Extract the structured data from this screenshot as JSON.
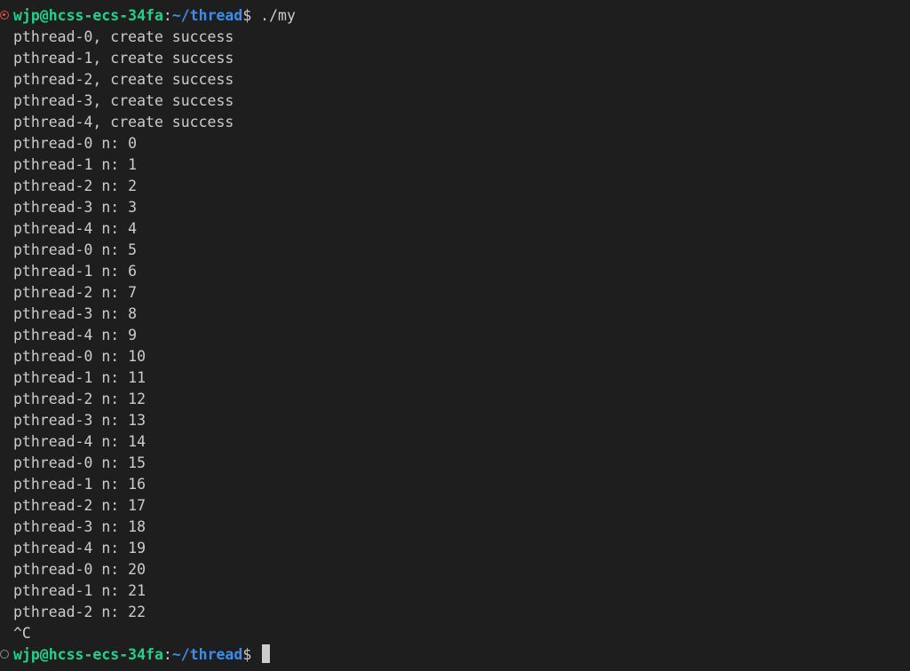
{
  "terminal": {
    "prompt": {
      "user_host": "wjp@hcss-ecs-34fa",
      "colon": ":",
      "path": "~/thread",
      "dollar": "$"
    },
    "command": " ./my",
    "output": [
      "pthread-0, create success",
      "pthread-1, create success",
      "pthread-2, create success",
      "pthread-3, create success",
      "pthread-4, create success",
      "pthread-0 n: 0",
      "pthread-1 n: 1",
      "pthread-2 n: 2",
      "pthread-3 n: 3",
      "pthread-4 n: 4",
      "pthread-0 n: 5",
      "pthread-1 n: 6",
      "pthread-2 n: 7",
      "pthread-3 n: 8",
      "pthread-4 n: 9",
      "pthread-0 n: 10",
      "pthread-1 n: 11",
      "pthread-2 n: 12",
      "pthread-3 n: 13",
      "pthread-4 n: 14",
      "pthread-0 n: 15",
      "pthread-1 n: 16",
      "pthread-2 n: 17",
      "pthread-3 n: 18",
      "pthread-4 n: 19",
      "pthread-0 n: 20",
      "pthread-1 n: 21",
      "pthread-2 n: 22",
      "^C"
    ],
    "colors": {
      "background": "#1e1e1e",
      "text": "#cccccc",
      "user_host": "#23d18b",
      "path": "#3b8eea",
      "error_decoration": "#f14c4c",
      "default_decoration": "#8a8a8a"
    },
    "decorations": {
      "first_command": "error-circle-icon",
      "current_prompt": "empty-circle-icon"
    }
  }
}
